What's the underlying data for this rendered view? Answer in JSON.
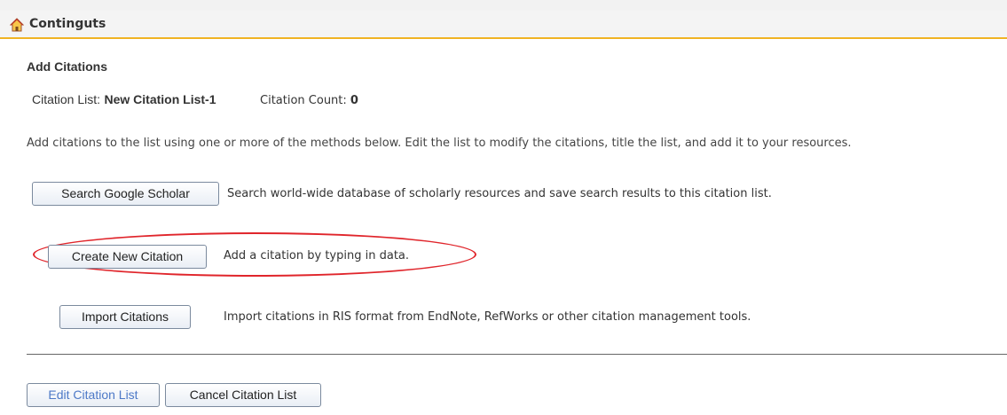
{
  "header": {
    "title": "Continguts",
    "icon": "home-icon",
    "accent_color": "#f0b323"
  },
  "section": {
    "title": "Add Citations"
  },
  "citation_list": {
    "label": "Citation List:",
    "name": "New Citation List-1",
    "count_label": "Citation Count:",
    "count_value": "0"
  },
  "intro_text": "Add citations to the list using one or more of the methods below. Edit the list to modify the citations, title the list, and add it to your resources.",
  "methods": {
    "google": {
      "button_label": "Search Google Scholar",
      "description": "Search world-wide database of scholarly resources and save search results to this citation list."
    },
    "create": {
      "button_label": "Create New Citation",
      "description": "Add a citation by typing in data."
    },
    "import": {
      "button_label": "Import Citations",
      "description": "Import citations in RIS format from EndNote, RefWorks or other citation management tools."
    }
  },
  "highlight_color": "#e0252b",
  "footer": {
    "edit_label": "Edit Citation List",
    "cancel_label": "Cancel Citation List"
  }
}
